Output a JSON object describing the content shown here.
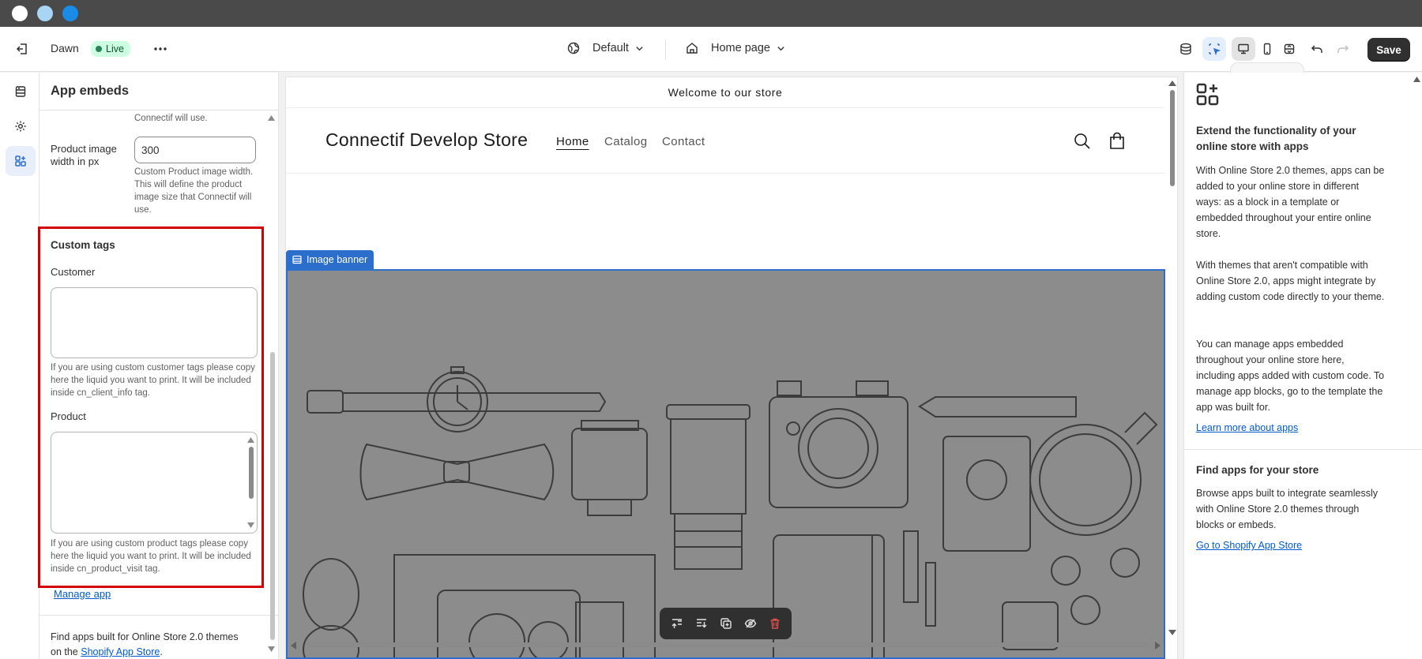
{
  "header": {
    "theme_name": "Dawn",
    "live_badge": "Live",
    "template_selector": "Default",
    "page_selector": "Home page",
    "save_label": "Save"
  },
  "sidebar": {
    "title": "App embeds",
    "prev_help_tail": "Connectif will use.",
    "product_image_width_label": "Product image width in px",
    "product_image_width_value": "300",
    "product_image_width_help": "Custom Product image width. This will define the product image size that Connectif will use.",
    "custom_tags_title": "Custom tags",
    "customer_label": "Customer",
    "customer_help": "If you are using custom customer tags please copy here the liquid you want to print. It will be included inside cn_client_info tag.",
    "product_label": "Product",
    "product_help": "If you are using custom product tags please copy here the liquid you want to print. It will be included inside cn_product_visit tag.",
    "manage_app": "Manage app",
    "find_apps_prefix": "Find apps built for Online Store 2.0 themes on the",
    "shopify_app_store": "Shopify App Store",
    "find_apps_suffix": "."
  },
  "preview": {
    "announcement": "Welcome to our store",
    "store_name": "Connectif Develop Store",
    "nav": [
      "Home",
      "Catalog",
      "Contact"
    ],
    "section_tag": "Image banner"
  },
  "right_panel": {
    "heading": "Extend the functionality of your online store with apps",
    "para1": "With Online Store 2.0 themes, apps can be added to your online store in different ways: as a block in a template or embedded throughout your entire online store.",
    "para2": "With themes that aren't compatible with Online Store 2.0, apps might integrate by adding custom code directly to your theme.",
    "para3": "You can manage apps embedded throughout your online store here, including apps added with custom code. To manage app blocks, go to the template the app was built for.",
    "learn_more": "Learn more about apps",
    "find_heading": "Find apps for your store",
    "find_text": "Browse apps built to integrate seamlessly with Online Store 2.0 themes through blocks or embeds.",
    "go_to_store": "Go to Shopify App Store"
  },
  "colors": {
    "accent": "#005bd3",
    "highlight_box": "#d40000",
    "banner_bg": "#8c8c8c",
    "selection": "#2c6ecb"
  }
}
